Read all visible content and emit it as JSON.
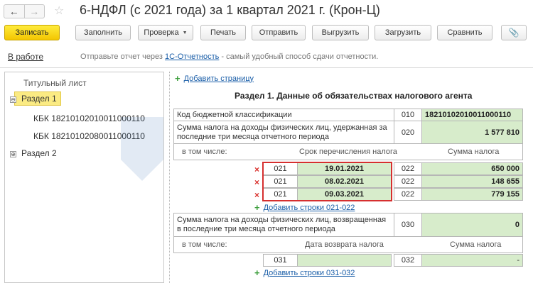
{
  "window": {
    "title": "6-НДФЛ (с 2021 года) за 1 квартал 2021 г. (Крон-Ц)",
    "back_glyph": "←",
    "forward_glyph": "→",
    "favorite_glyph": "☆"
  },
  "toolbar": {
    "record_label": "Записать",
    "fill_label": "Заполнить",
    "check_label": "Проверка",
    "check_caret": "▼",
    "print_label": "Печать",
    "send_label": "Отправить",
    "export_label": "Выгрузить",
    "import_label": "Загрузить",
    "compare_label": "Сравнить",
    "attach_icon": "paperclip-icon",
    "attach_glyph": "📎"
  },
  "status": {
    "state_label": "В работе",
    "hint_before": "Отправьте отчет через ",
    "hint_link": "1С-Отчетность",
    "hint_after": " - самый удобный способ сдачи отчетности."
  },
  "tree": {
    "items": [
      {
        "label": "Титульный лист"
      },
      {
        "label": "Раздел 1",
        "toggle": "⊖",
        "selected": true
      },
      {
        "label": "КБК 18210102010011000110"
      },
      {
        "label": "КБК 18210102080011000110"
      },
      {
        "label": "Раздел 2",
        "toggle": "⊕"
      }
    ]
  },
  "form": {
    "add_page_label": "Добавить страницу",
    "section_title": "Раздел 1. Данные об обязательствах налогового агента",
    "kbk_label": "Код бюджетной классификации",
    "kbk_code": "010",
    "kbk_value": "18210102010011000110",
    "withheld_label": "Сумма налога на доходы физических лиц, удержанная за последние три месяца отчетного периода",
    "withheld_code": "020",
    "withheld_value": "1 577 810",
    "including_label": "в том числе:",
    "due_date_header": "Срок перечисления налога",
    "tax_amount_header": "Сумма налога",
    "delete_glyph": "×",
    "rows": [
      {
        "code_date": "021",
        "date": "19.01.2021",
        "code_amount": "022",
        "amount": "650 000"
      },
      {
        "code_date": "021",
        "date": "08.02.2021",
        "code_amount": "022",
        "amount": "148 655"
      },
      {
        "code_date": "021",
        "date": "09.03.2021",
        "code_amount": "022",
        "amount": "779 155"
      }
    ],
    "add_rows_021_label": "Добавить строки 021-022",
    "returned_label": "Сумма налога на доходы физических лиц, возвращенная в последние три месяца отчетного периода",
    "returned_code": "030",
    "returned_value": "0",
    "including_label_2": "в том числе:",
    "return_date_header": "Дата возврата налога",
    "return_amount_header": "Сумма налога",
    "return_row": {
      "code_date": "031",
      "date": "",
      "code_amount": "032",
      "amount": "-"
    },
    "add_rows_031_label": "Добавить строки 031-032"
  },
  "colors": {
    "primary_button": "#f3c600",
    "green_cell": "#d7eccb",
    "highlight_border": "#d62f2f",
    "link": "#1a5ea8"
  }
}
